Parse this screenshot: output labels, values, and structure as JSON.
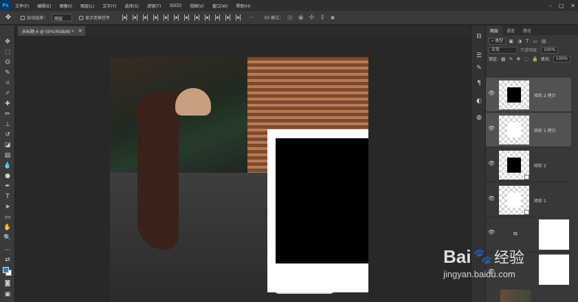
{
  "app": {
    "logo": "Ps"
  },
  "menubar": {
    "items": [
      "文件(F)",
      "编辑(E)",
      "图像(I)",
      "图层(L)",
      "文字(Y)",
      "选择(S)",
      "滤镜(T)",
      "3D(D)",
      "视图(V)",
      "窗口(W)",
      "帮助(H)"
    ]
  },
  "options": {
    "auto_select_label": "自动选择：",
    "auto_select_value": "图层",
    "transform_label": "显示变换控件",
    "mode_3d_label": "3D 模式：",
    "more": "···"
  },
  "document": {
    "tab_label": "未标题-4 @ 50%(RGB/8) *",
    "close": "×"
  },
  "layers_panel": {
    "tabs": [
      "图层",
      "通道",
      "路径"
    ],
    "filter_label": "类型",
    "blend_mode": "正常",
    "opacity_label": "不透明度:",
    "opacity_value": "100%",
    "lock_label": "锁定:",
    "fill_label": "填充:",
    "fill_value": "100%",
    "layers": [
      {
        "name": "矩形 2 拷贝",
        "thumb": "black"
      },
      {
        "name": "矩形 1 拷贝",
        "thumb": "white"
      },
      {
        "name": "矩形 2",
        "thumb": "black"
      },
      {
        "name": "矩形 1",
        "thumb": "white"
      }
    ]
  },
  "watermark": {
    "brand": "Bai",
    "brand_tail": "经验",
    "url": "jingyan.baidu.com"
  },
  "colors": {
    "foreground": "#3c78c8",
    "background": "#ffffff",
    "polaroid_frame": "#ffffff",
    "polaroid_photo": "#000000"
  }
}
